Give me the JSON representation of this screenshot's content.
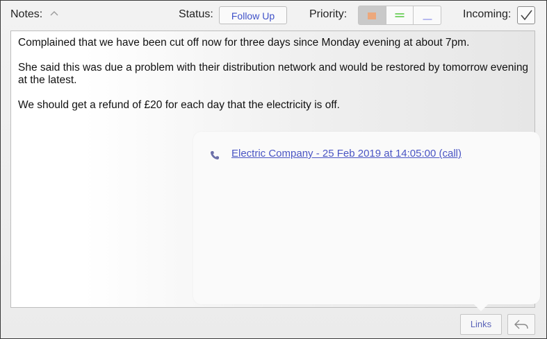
{
  "toolbar": {
    "notes_label": "Notes:",
    "status_label": "Status:",
    "status_value": "Follow Up",
    "priority_label": "Priority:",
    "priority_selected": "high",
    "incoming_label": "Incoming:",
    "incoming_checked": true
  },
  "notes": {
    "paragraphs": [
      "Complained that we have been cut off now for three days since Monday evening at about 7pm.",
      "She said this was due a problem with their distribution network and would be restored by tomorrow evening at the latest.",
      "We should get a refund of £20 for each day that the electricity is off."
    ]
  },
  "links_popover": {
    "items": [
      {
        "icon": "phone-icon",
        "text": "Electric Company - 25 Feb 2019 at 14:05:00 (call)"
      }
    ]
  },
  "footer": {
    "links_label": "Links"
  },
  "colors": {
    "accent": "#4a55c4",
    "priority_high": "#f2a26e",
    "priority_medium": "#7bd36b",
    "priority_low": "#b7b9f0"
  }
}
